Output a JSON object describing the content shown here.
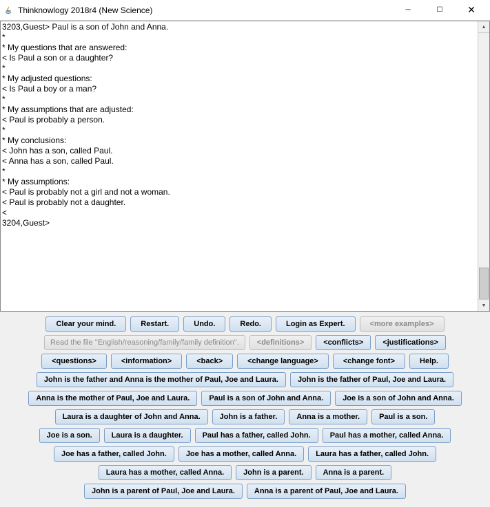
{
  "window": {
    "title": "Thinknowlogy 2018r4 (New Science)"
  },
  "console": {
    "text": "3203,Guest> Paul is a son of John and Anna.\n*\n* My questions that are answered:\n< Is Paul a son or a daughter?\n*\n* My adjusted questions:\n< Is Paul a boy or a man?\n*\n* My assumptions that are adjusted:\n< Paul is probably a person.\n*\n* My conclusions:\n< John has a son, called Paul.\n< Anna has a son, called Paul.\n*\n* My assumptions:\n< Paul is probably not a girl and not a woman.\n< Paul is probably not a daughter.\n<\n3204,Guest>"
  },
  "toolbar1": {
    "clear": "Clear your mind.",
    "restart": "Restart.",
    "undo": "Undo.",
    "redo": "Redo.",
    "login": "Login as Expert.",
    "more": "<more examples>"
  },
  "toolbar2": {
    "readfile": "Read the file \"English/reasoning/family/family definition\".",
    "definitions": "<definitions>",
    "conflicts": "<conflicts>",
    "justifications": "<justifications>"
  },
  "toolbar3": {
    "questions": "<questions>",
    "information": "<information>",
    "back": "<back>",
    "changelang": "<change language>",
    "changefont": "<change font>",
    "help": "Help."
  },
  "examples": {
    "e1": "John is the father and Anna is the mother of Paul, Joe and Laura.",
    "e2": "John is the father of Paul, Joe and Laura.",
    "e3": "Anna is the mother of Paul, Joe and Laura.",
    "e4": "Paul is a son of John and Anna.",
    "e5": "Joe is a son of John and Anna.",
    "e6": "Laura is a daughter of John and Anna.",
    "e7": "John is a father.",
    "e8": "Anna is a mother.",
    "e9": "Paul is a son.",
    "e10": "Joe is a son.",
    "e11": "Laura is a daughter.",
    "e12": "Paul has a father, called John.",
    "e13": "Paul has a mother, called Anna.",
    "e14": "Joe has a father, called John.",
    "e15": "Joe has a mother, called Anna.",
    "e16": "Laura has a father, called John.",
    "e17": "Laura has a mother, called Anna.",
    "e18": "John is a parent.",
    "e19": "Anna is a parent.",
    "e20": "John is a parent of Paul, Joe and Laura.",
    "e21": "Anna is a parent of Paul, Joe and Laura."
  }
}
